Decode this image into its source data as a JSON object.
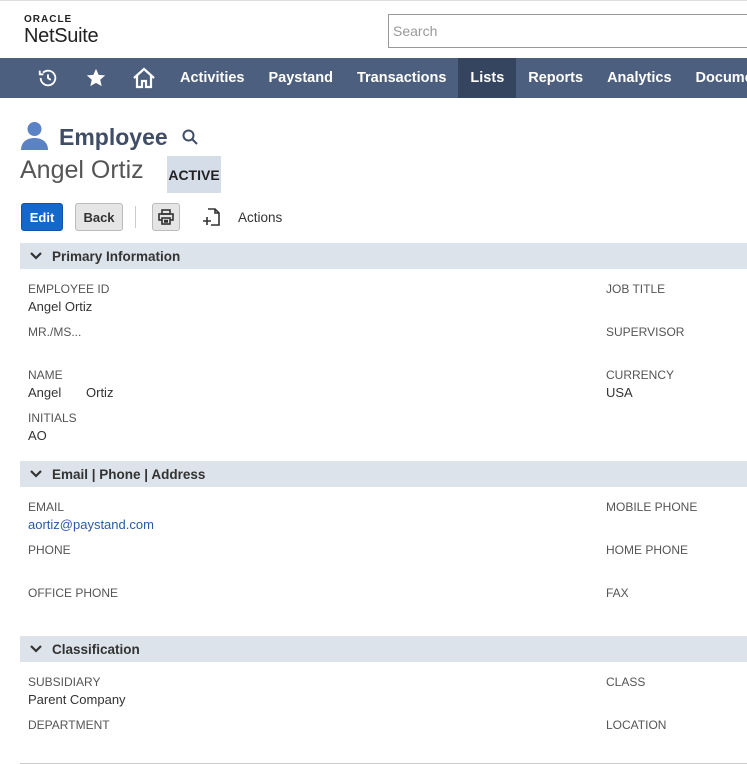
{
  "header": {
    "logo_oracle": "ORACLE",
    "logo_netsuite": "NetSuite",
    "search_placeholder": "Search"
  },
  "nav": {
    "items": [
      "Activities",
      "Paystand",
      "Transactions",
      "Lists",
      "Reports",
      "Analytics",
      "Documents"
    ],
    "active": "Lists"
  },
  "record": {
    "type": "Employee",
    "name": "Angel Ortiz",
    "status": "ACTIVE"
  },
  "toolbar": {
    "edit_label": "Edit",
    "back_label": "Back",
    "actions_label": "Actions"
  },
  "sections": {
    "primary": {
      "title": "Primary Information",
      "employee_id_label": "EMPLOYEE ID",
      "employee_id_value": "Angel Ortiz",
      "mrms_label": "MR./MS...",
      "name_label": "NAME",
      "first_name": "Angel",
      "last_name": "Ortiz",
      "initials_label": "INITIALS",
      "initials_value": "AO",
      "job_title_label": "JOB TITLE",
      "supervisor_label": "SUPERVISOR",
      "currency_label": "CURRENCY",
      "currency_value": "USA"
    },
    "contact": {
      "title": "Email | Phone | Address",
      "email_label": "EMAIL",
      "email_value": "aortiz@paystand.com",
      "phone_label": "PHONE",
      "office_phone_label": "OFFICE PHONE",
      "mobile_phone_label": "MOBILE PHONE",
      "home_phone_label": "HOME PHONE",
      "fax_label": "FAX"
    },
    "classification": {
      "title": "Classification",
      "subsidiary_label": "SUBSIDIARY",
      "subsidiary_value": "Parent Company",
      "department_label": "DEPARTMENT",
      "class_label": "CLASS",
      "location_label": "LOCATION"
    }
  },
  "colors": {
    "nav_bg": "#4d5f7e",
    "nav_active": "#35445f",
    "edit_button": "#1467cc",
    "section_bg": "#dce3ea",
    "record_title": "#3f4d66"
  }
}
